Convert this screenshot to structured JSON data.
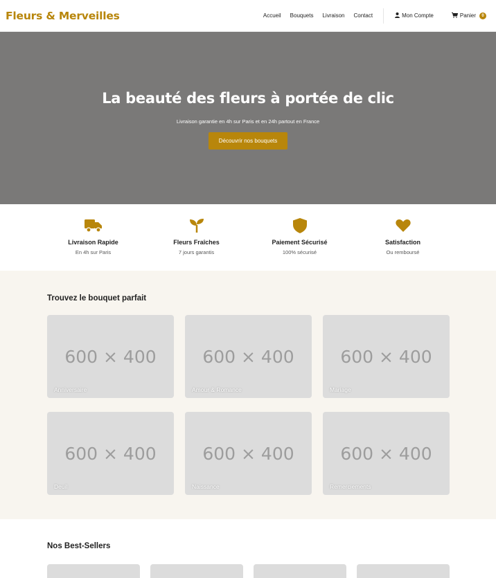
{
  "brand": {
    "name": "Fleurs & Merveilles",
    "accent": "#b8860b"
  },
  "nav": {
    "links": [
      "Accueil",
      "Bouquets",
      "Livraison",
      "Contact"
    ],
    "account_label": "Mon Compte",
    "cart_label": "Panier",
    "cart_count": "0"
  },
  "hero": {
    "title": "La beauté des fleurs à portée de clic",
    "subtitle": "Livraison garantie en 4h sur Paris et en 24h partout en France",
    "cta": "Découvrir nos bouquets"
  },
  "features": [
    {
      "icon": "truck-icon",
      "title": "Livraison Rapide",
      "subtitle": "En 4h sur Paris"
    },
    {
      "icon": "seedling-icon",
      "title": "Fleurs Fraîches",
      "subtitle": "7 jours garantis"
    },
    {
      "icon": "shield-icon",
      "title": "Paiement Sécurisé",
      "subtitle": "100% sécurisé"
    },
    {
      "icon": "heart-icon",
      "title": "Satisfaction",
      "subtitle": "Ou remboursé"
    }
  ],
  "occasions": {
    "title": "Trouvez le bouquet parfait",
    "placeholder": "600 × 400",
    "items": [
      "Anniversaire",
      "Amour & Romance",
      "Mariage",
      "Deuil",
      "Naissance",
      "Remerciements"
    ]
  },
  "bestsellers": {
    "title": "Nos Best-Sellers"
  }
}
